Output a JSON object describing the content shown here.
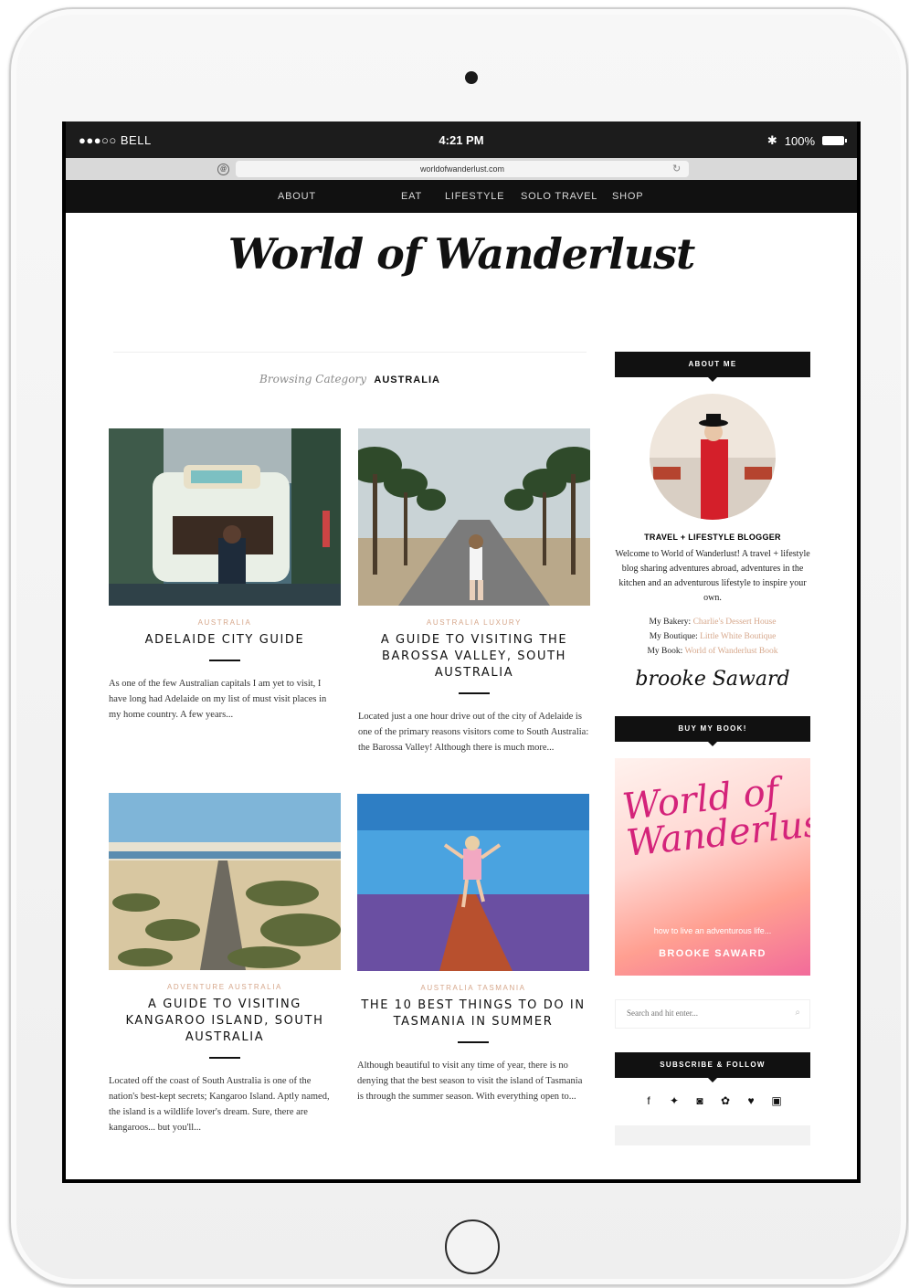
{
  "status": {
    "carrier": "●●●○○ BELL",
    "wifi": "wifi-icon",
    "time": "4:21 PM",
    "bluetooth": "bluetooth-icon",
    "battery": "100%"
  },
  "browser": {
    "url": "worldofwanderlust.com"
  },
  "nav": {
    "items": [
      "ABOUT",
      "EAT",
      "LIFESTYLE",
      "SOLO TRAVEL",
      "SHOP"
    ]
  },
  "site": {
    "logo": "World of Wanderlust"
  },
  "category": {
    "prefix": "Browsing Category",
    "name": "AUSTRALIA"
  },
  "posts": [
    {
      "categories": "AUSTRALIA",
      "title": "ADELAIDE CITY GUIDE",
      "excerpt": "As one of the few Australian capitals I am yet to visit, I have long had Adelaide on my list of must visit places in my home country. A few years..."
    },
    {
      "categories": "AUSTRALIA   LUXURY",
      "title": "A GUIDE TO VISITING THE BAROSSA VALLEY, SOUTH AUSTRALIA",
      "excerpt": "Located just a one hour drive out of the city of Adelaide is one of the primary reasons visitors come to South Australia: the Barossa Valley! Although there is much more..."
    },
    {
      "categories": "ADVENTURE   AUSTRALIA",
      "title": "A GUIDE TO VISITING KANGAROO ISLAND, SOUTH AUSTRALIA",
      "excerpt": "Located off the coast of South Australia is one of the nation's best-kept secrets; Kangaroo Island. Aptly named, the island is a wildlife lover's dream. Sure, there are kangaroos... but you'll..."
    },
    {
      "categories": "AUSTRALIA   TASMANIA",
      "title": "THE 10 BEST THINGS TO DO IN TASMANIA IN SUMMER",
      "excerpt": "Although beautiful to visit any time of year, there is no denying that the best season to visit the island of Tasmania is through the summer season. With everything open to..."
    }
  ],
  "sidebar": {
    "about_title": "ABOUT ME",
    "about_heading": "TRAVEL + LIFESTYLE BLOGGER",
    "about_text": "Welcome to World of Wanderlust! A travel + lifestyle blog sharing adventures abroad, adventures in the kitchen and an adventurous lifestyle to inspire your own.",
    "links": [
      {
        "label": "My Bakery:",
        "value": "Charlie's Dessert House"
      },
      {
        "label": "My Boutique:",
        "value": "Little White Boutique"
      },
      {
        "label": "My Book:",
        "value": "World of Wanderlust Book"
      }
    ],
    "signature": "brooke Saward",
    "book_title": "BUY MY BOOK!",
    "book_cover": {
      "title": "World of Wanderlust",
      "subtitle": "how to live an adventurous life...",
      "author": "BROOKE SAWARD"
    },
    "search_placeholder": "Search and hit enter...",
    "follow_title": "SUBSCRIBE & FOLLOW",
    "social": [
      "facebook-icon",
      "twitter-icon",
      "instagram-icon",
      "pinterest-icon",
      "heart-icon",
      "youtube-icon"
    ]
  },
  "colors": {
    "accent": "#d6a78b",
    "dark": "#111111"
  }
}
